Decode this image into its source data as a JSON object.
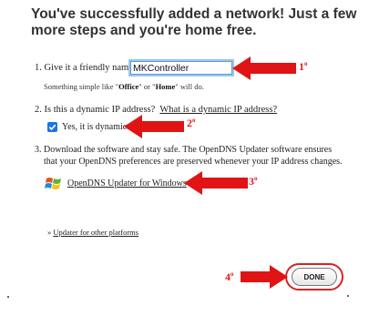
{
  "heading": "You've successfully added a network! Just a few more steps and you're home free.",
  "step1": {
    "label": "1. Give it a friendly name:",
    "value": "MKController",
    "hint_prefix": "Something simple like \"",
    "hint_office": "Office",
    "hint_mid": "\" or \"",
    "hint_home": "Home",
    "hint_suffix": "\" will do."
  },
  "step2": {
    "label": "2. Is this a dynamic IP address?",
    "link": "What is a dynamic IP address?",
    "checkbox_label": "Yes, it is dynamic",
    "checked": true
  },
  "step3": {
    "line1": "3. Download the software and stay safe. The OpenDNS Updater software ensures",
    "line2": "that your OpenDNS preferences are preserved whenever your IP address changes.",
    "download_link": "OpenDNS Updater for Windows",
    "icon": "windows-logo-icon"
  },
  "other_platforms": {
    "prefix": "» ",
    "link": "Updater for other platforms"
  },
  "done_button": "DONE",
  "annotations": {
    "n1": "1",
    "n2": "2",
    "n3": "3",
    "n4": "4",
    "sup": "o",
    "color": "#e21b1b"
  }
}
